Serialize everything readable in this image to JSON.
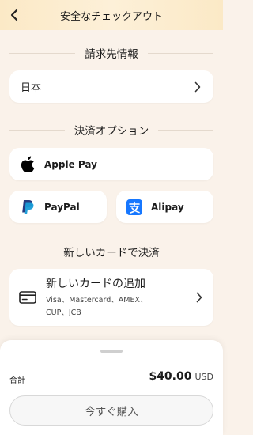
{
  "header": {
    "title": "安全なチェックアウト"
  },
  "billing": {
    "section_title": "請求先情報",
    "country": "日本"
  },
  "payment_options": {
    "section_title": "決済オプション",
    "apple_pay": "Apple Pay",
    "paypal": "PayPal",
    "alipay": "Alipay"
  },
  "new_card": {
    "section_title": "新しいカードで決済",
    "title": "新しいカードの追加",
    "brands": "Visa、Mastercard、AMEX、CUP、JCB"
  },
  "summary": {
    "total_label": "合計",
    "amount": "$40.00",
    "currency": "USD",
    "buy_label": "今すぐ購入"
  },
  "colors": {
    "header_bg": "#fbe9c6",
    "page_bg": "#faf2ea",
    "paypal_dark": "#253b80",
    "paypal_light": "#179bd7",
    "alipay_blue": "#1677ff"
  }
}
